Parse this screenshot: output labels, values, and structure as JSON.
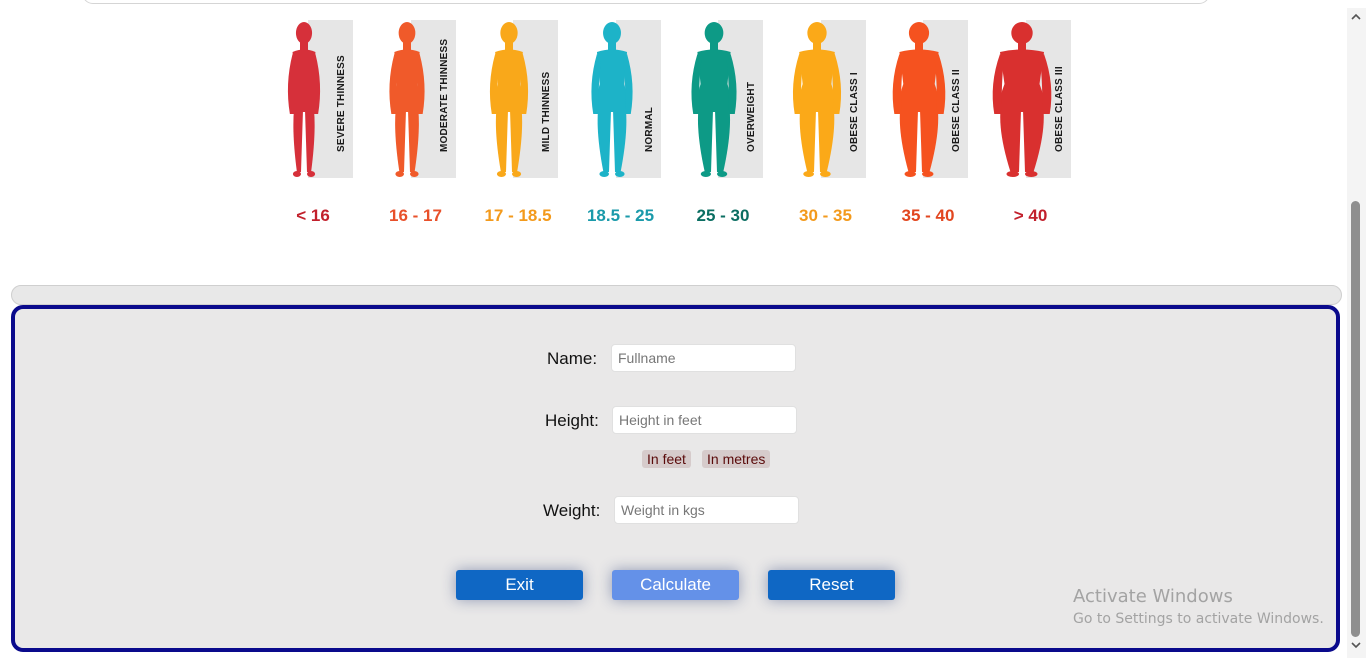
{
  "bmi_chart": {
    "categories": [
      {
        "label": "SEVERE THINNESS",
        "range": "< 16",
        "color": "#d6303a",
        "range_color": "#c2202c",
        "build": 0.62
      },
      {
        "label": "MODERATE THINNESS",
        "range": "16 - 17",
        "color": "#f05a2a",
        "range_color": "#e8502a",
        "build": 0.72
      },
      {
        "label": "MILD THINNESS",
        "range": "17 - 18.5",
        "color": "#f9a81a",
        "range_color": "#f39a1c",
        "build": 0.82
      },
      {
        "label": "NORMAL",
        "range": "18.5 - 25",
        "color": "#1db3c8",
        "range_color": "#1a9aaa",
        "build": 0.92
      },
      {
        "label": "OVERWEIGHT",
        "range": "25 - 30",
        "color": "#0d9a86",
        "range_color": "#0b6e62",
        "build": 1.05
      },
      {
        "label": "OBESE CLASS I",
        "range": "30 - 35",
        "color": "#fba918",
        "range_color": "#f39a1c",
        "build": 1.15
      },
      {
        "label": "OBESE CLASS II",
        "range": "35 - 40",
        "color": "#f5521f",
        "range_color": "#e2461f",
        "build": 1.3
      },
      {
        "label": "OBESE CLASS III",
        "range": "> 40",
        "color": "#d9302f",
        "range_color": "#c2202c",
        "build": 1.5
      }
    ]
  },
  "form": {
    "name_label": "Name:",
    "name_placeholder": "Fullname",
    "height_label": "Height:",
    "height_placeholder": "Height in feet",
    "unit_feet": "In feet",
    "unit_metres": "In metres",
    "weight_label": "Weight:",
    "weight_placeholder": "Weight in kgs",
    "exit_label": "Exit",
    "calculate_label": "Calculate",
    "reset_label": "Reset"
  },
  "watermark": {
    "title": "Activate Windows",
    "subtitle": "Go to Settings to activate Windows."
  },
  "colors": {
    "panel_border": "#0a0a8c",
    "primary_button": "#0f67c4",
    "calculate_button": "#6491e8"
  }
}
